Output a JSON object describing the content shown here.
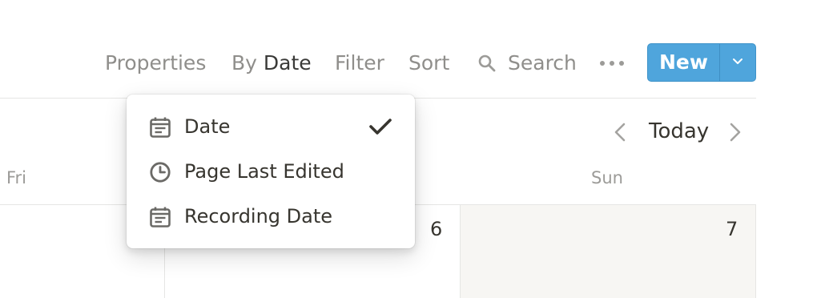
{
  "toolbar": {
    "properties_label": "Properties",
    "group_by_prefix": "By",
    "group_by_value": "Date",
    "filter_label": "Filter",
    "sort_label": "Sort",
    "search_label": "Search",
    "more_icon": "ellipsis-icon",
    "new_label": "New",
    "new_dropdown_icon": "chevron-down-icon",
    "accent_color": "#4fa5dc"
  },
  "calendar": {
    "today_label": "Today",
    "prev_icon": "chevron-left-icon",
    "next_icon": "chevron-right-icon",
    "day_headers": [
      "Fri",
      "Sun"
    ],
    "dates": [
      "6",
      "7"
    ]
  },
  "date_property_menu": {
    "items": [
      {
        "icon": "calendar-icon",
        "label": "Date",
        "selected": true
      },
      {
        "icon": "clock-icon",
        "label": "Page Last Edited",
        "selected": false
      },
      {
        "icon": "calendar-icon",
        "label": "Recording Date",
        "selected": false
      }
    ],
    "check_icon": "checkmark-icon"
  }
}
